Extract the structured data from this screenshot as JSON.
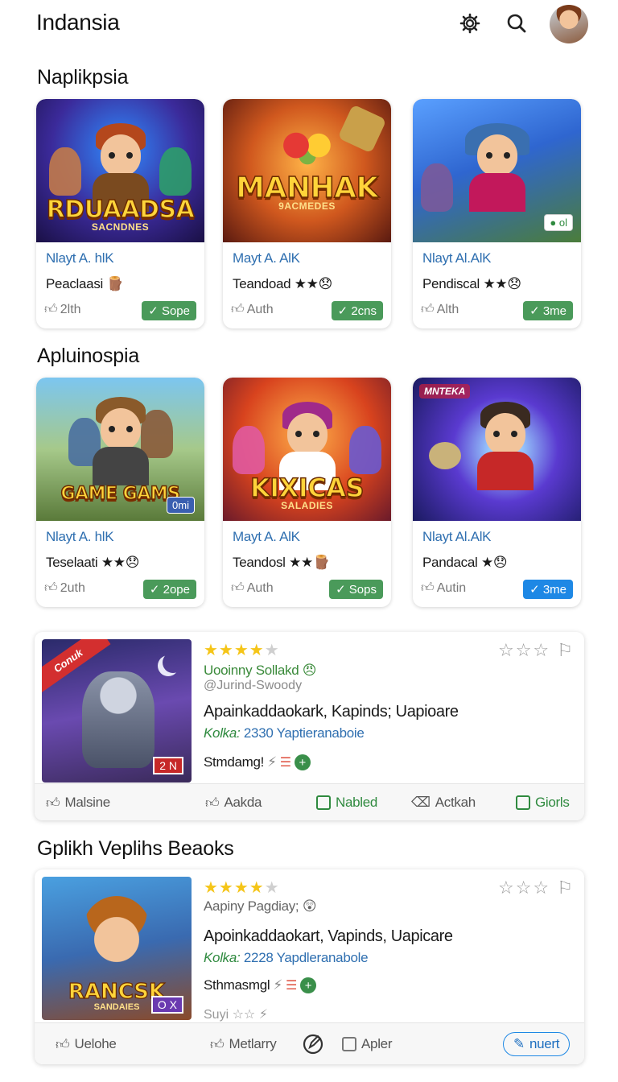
{
  "header": {
    "title": "Indansia"
  },
  "sections": [
    {
      "title": "Naplikpsia"
    },
    {
      "title": "Apluinospia"
    },
    {
      "title": "Gplikh Veplihs Beaoks"
    }
  ],
  "cards_row1": [
    {
      "logo": "RDUAADSA",
      "sublogo": "SACNDNES",
      "author": "Nlayt A. hlK",
      "name": "Peaclaasi",
      "name_icon": "🪵",
      "like": "2lth",
      "state": "✓ Sope",
      "state_color": "green"
    },
    {
      "logo": "MANHAK",
      "sublogo": "9ACMEDES",
      "author": "Mayt A. AlK",
      "name": "Teandoad",
      "name_icon": "★★😞",
      "like": "Auth",
      "state": "✓ 2cns",
      "state_color": "green",
      "tag": ""
    },
    {
      "logo": "",
      "sublogo": "",
      "author": "Nlayt Al.AlK",
      "name": "Pendiscal",
      "name_icon": "★★😞",
      "like": "Alth",
      "state": "✓ 3me",
      "state_color": "green",
      "tag": "● ol"
    }
  ],
  "cards_row2": [
    {
      "logo": "GAME GAMS",
      "sublogo": "",
      "author": "Nlayt A. hlK",
      "name": "Teselaati",
      "name_icon": "★★😞",
      "like": "2uth",
      "state": "✓ 2ope",
      "state_color": "green",
      "tag": "0mi"
    },
    {
      "logo": "KIXICAS",
      "sublogo": "SALADIES",
      "author": "Mayt A. AlK",
      "name": "Teandosl",
      "name_icon": "★★🪵",
      "like": "Auth",
      "state": "✓ Sops",
      "state_color": "green"
    },
    {
      "logo": "",
      "sublogo": "",
      "author": "Nlayt Al.AlK",
      "name": "Pandacal",
      "name_icon": "★😞",
      "like": "Autin",
      "state": "✓ 3me",
      "state_color": "blue",
      "tag": "MNTEKA"
    }
  ],
  "list1": {
    "ribbon": "Conuk",
    "badge": "2 N",
    "rating_stars": 4,
    "subtitle": "Uooinny Sollakd",
    "subtitle_icon": "😠",
    "handle": "@Jurind-Swoody",
    "title": "Apainkaddaokark, Kapinds; Uapioare",
    "meta_key": "Kolka:",
    "meta_value": "2330 Yaptieranaboie",
    "status": "Stmdamg!",
    "actions": [
      {
        "label": "Malsine",
        "icon": "thumb-icon"
      },
      {
        "label": "Aakda",
        "icon": "thumb-icon"
      },
      {
        "label": "Nabled",
        "icon": "comment-icon"
      },
      {
        "label": "Actkah",
        "icon": "tag-icon"
      },
      {
        "label": "Giorls",
        "icon": "comment-icon"
      }
    ]
  },
  "list2": {
    "logo": "RANCSK",
    "sublogo": "SANDAIES",
    "badge": "O X",
    "rating_stars": 4,
    "subtitle": "Aapiny Pagdiay;",
    "subtitle_icon": "😲",
    "title": "Apoinkaddaokart, Vapinds, Uapicare",
    "meta_key": "Kolka:",
    "meta_value": "2228 Yapdleranabole",
    "status": "Sthmasmgl",
    "extra": "Suyi ☆☆ ⚡",
    "actions": [
      {
        "label": "Uelohe",
        "icon": "thumb-icon"
      },
      {
        "label": "Metlarry",
        "icon": "thumb-icon"
      },
      {
        "label": "",
        "icon": "edit-icon"
      },
      {
        "label": "Apler",
        "icon": "checkbox-icon"
      },
      {
        "label": "nuert",
        "icon": "pen-icon"
      }
    ]
  },
  "colors": {
    "accent_blue": "#1e88e5",
    "accent_green": "#4a9a5a",
    "star": "#f5c518",
    "link": "#2f6fb0"
  }
}
